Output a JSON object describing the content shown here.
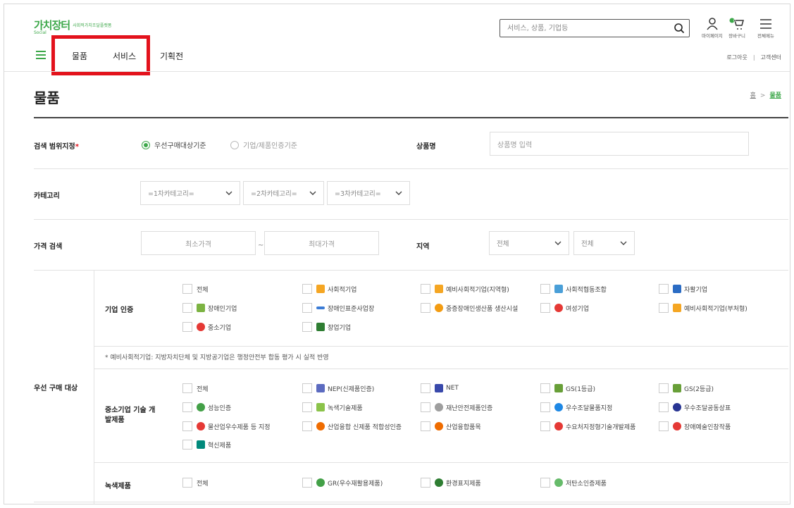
{
  "header": {
    "logo_main": "가치장터",
    "logo_sub": "사회적가치조달플랫폼",
    "logo_tag": "Social",
    "search_placeholder": "서비스, 상품, 기업등",
    "utils": [
      {
        "label": "마이페이지",
        "icon": "user-icon"
      },
      {
        "label": "장바구니",
        "icon": "cart-icon",
        "badge": "0"
      },
      {
        "label": "전체메뉴",
        "icon": "menu-icon"
      }
    ],
    "nav": [
      "물품",
      "서비스",
      "기획전"
    ],
    "logout": "로그아웃",
    "separator": "|",
    "customer_center": "고객센터",
    "accent": "#3da84a",
    "highlight_color": "#e3121c"
  },
  "page": {
    "title": "물품",
    "breadcrumb_home": "홈",
    "breadcrumb_arrow": ">",
    "breadcrumb_current": "물품"
  },
  "form": {
    "scope_label": "검색 범위지정",
    "scope_required": "*",
    "scope_options": [
      "우선구매대상기준",
      "기업/제품인증기준"
    ],
    "scope_selected": "우선구매대상기준",
    "product_name_label": "상품명",
    "product_name_placeholder": "상품명 입력",
    "category_label": "카테고리",
    "category_selects": [
      "=1차카테고리=",
      "=2차카테고리=",
      "=3차카테고리="
    ],
    "price_label": "가격 검색",
    "price_min_placeholder": "최소가격",
    "price_sep": "~",
    "price_max_placeholder": "최대가격",
    "region_label": "지역",
    "region_selects": [
      "전체",
      "전체"
    ]
  },
  "priority": {
    "label": "우선 구매 대상",
    "groups": [
      {
        "name": "기업 인증",
        "items": [
          "전체",
          "사회적기업",
          "예비사회적기업(지역형)",
          "사회적협동조합",
          "자활기업",
          "장애인기업",
          "장애인표준사업장",
          "중증장애인생산품 생산시설",
          "여성기업",
          "예비사회적기업(부처형)",
          "중소기업",
          "창업기업"
        ]
      },
      {
        "note": "* 예비사회적기업: 지방자치단체 및 지방공기업은 행정안전부 합동 평가 시 실적 반영"
      },
      {
        "name": "중소기업 기술 개발제품",
        "items": [
          "전체",
          "NEP(신제품인증)",
          "NET",
          "GS(1등급)",
          "GS(2등급)",
          "성능인증",
          "녹색기술제품",
          "재난안전제품인증",
          "우수조달물품지정",
          "우수조달공동상표",
          "물산업우수제품 등 지정",
          "산업융합 신제품 적합성인증",
          "산업융합품목",
          "수요처지정형기술개발제품",
          "장애예술인창작품",
          "혁신제품"
        ]
      },
      {
        "name": "녹색제품",
        "items": [
          "전체",
          "GR(우수재활용제품)",
          "환경표지제품",
          "저탄소인증제품"
        ]
      }
    ]
  }
}
